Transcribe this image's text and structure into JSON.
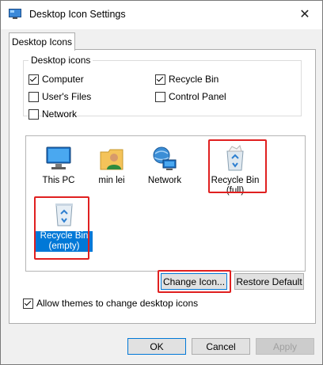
{
  "window": {
    "title": "Desktop Icon Settings"
  },
  "tabs": [
    {
      "label": "Desktop Icons"
    }
  ],
  "desktop_icons_group": {
    "legend": "Desktop icons",
    "options": [
      {
        "label": "Computer",
        "checked": true
      },
      {
        "label": "Recycle Bin",
        "checked": true
      },
      {
        "label": "User's Files",
        "checked": false
      },
      {
        "label": "Control Panel",
        "checked": false
      },
      {
        "label": "Network",
        "checked": false
      }
    ]
  },
  "icon_list": [
    {
      "label": "This PC",
      "icon": "computer-icon"
    },
    {
      "label": "min lei",
      "icon": "user-folder-icon"
    },
    {
      "label": "Network",
      "icon": "network-icon"
    },
    {
      "label": "Recycle Bin (full)",
      "icon": "recycle-bin-full-icon"
    },
    {
      "label": "Recycle Bin (empty)",
      "icon": "recycle-bin-empty-icon",
      "selected": true
    }
  ],
  "buttons": {
    "change_icon": "Change Icon...",
    "restore_default": "Restore Default",
    "ok": "OK",
    "cancel": "Cancel",
    "apply": "Apply"
  },
  "allow_themes": {
    "label": "Allow themes to change desktop icons",
    "checked": true
  },
  "colors": {
    "highlight": "#e02020",
    "selection": "#0078d7",
    "accent_focus": "#0078d7"
  }
}
